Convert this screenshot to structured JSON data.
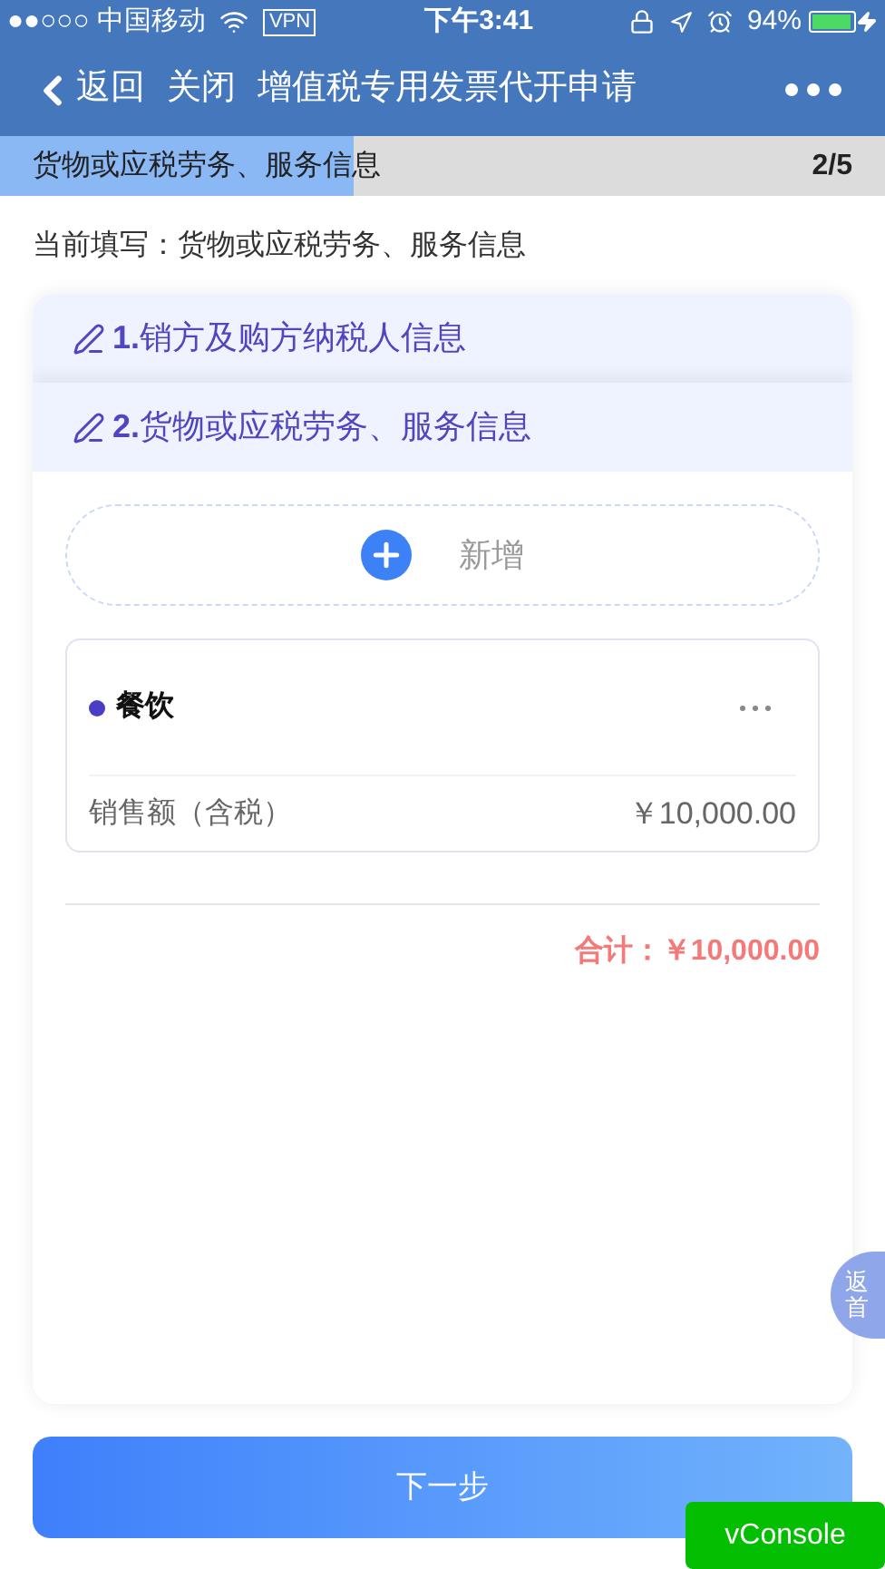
{
  "status_bar": {
    "carrier": "●●○○○ 中国移动",
    "vpn": "VPN",
    "time": "下午3:41",
    "battery": "94%"
  },
  "nav": {
    "back": "返回",
    "close": "关闭",
    "title": "增值税专用发票代开申请"
  },
  "progress": {
    "label": "货物或应税劳务、服务信息",
    "step": "2/5",
    "level": 0.4
  },
  "current": "当前填写：货物或应税劳务、服务信息",
  "sections": [
    {
      "number": "1.",
      "title": "销方及购方纳税人信息"
    },
    {
      "number": "2.",
      "title": "货物或应税劳务、服务信息"
    }
  ],
  "add_button": "新增",
  "items": [
    {
      "name": "餐饮",
      "color": "#4a3fc4",
      "field_label": "销售额（含税）",
      "amount": "￥10,000.00"
    }
  ],
  "total": "合计：￥10,000.00",
  "home_button": [
    "返",
    "首"
  ],
  "next_button": "下一步",
  "vconsole": "vConsole"
}
